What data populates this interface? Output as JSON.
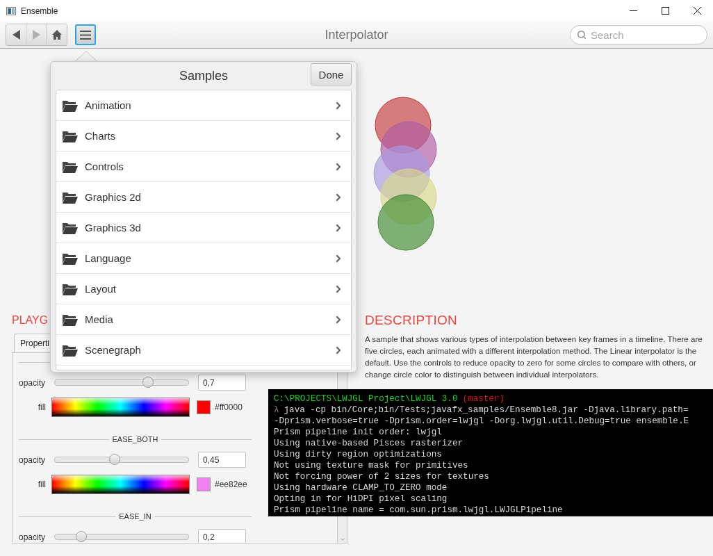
{
  "window": {
    "title": "Ensemble"
  },
  "toolbar": {
    "nav_buttons": [
      {
        "kind": "back",
        "disabled": false
      },
      {
        "kind": "forward",
        "disabled": true
      },
      {
        "kind": "home",
        "disabled": false
      }
    ],
    "menu_button": {
      "selected": true
    },
    "title": "Interpolator",
    "search": {
      "placeholder": "Search"
    }
  },
  "circles": [
    {
      "color": "#c23b3e"
    },
    {
      "color": "#b05ca8"
    },
    {
      "color": "#a99ae0"
    },
    {
      "color": "#d8d888"
    },
    {
      "color": "#3f8a30"
    }
  ],
  "playground": {
    "heading": "PLAYG",
    "tabs": [
      {
        "label": "Properti",
        "selected": true
      }
    ],
    "rows": [
      {
        "kind": "separator"
      },
      {
        "kind": "slider",
        "label": "opacity",
        "level": 0.7,
        "value": "0,7"
      },
      {
        "kind": "color",
        "label": "fill",
        "color": "#ff0000",
        "value": "#ff0000"
      },
      {
        "kind": "separator",
        "title": "EASE_BOTH"
      },
      {
        "kind": "slider",
        "label": "opacity",
        "level": 0.45,
        "value": "0,45"
      },
      {
        "kind": "color",
        "label": "fill",
        "color": "#ee82ee",
        "value": "#ee82ee"
      },
      {
        "kind": "separator",
        "title": "EASE_IN"
      },
      {
        "kind": "slider",
        "label": "opacity",
        "level": 0.2,
        "value": "0,2"
      }
    ]
  },
  "description": {
    "heading": "DESCRIPTION",
    "text": "A sample that shows various types of interpolation between key frames in a timeline. There are five circles, each animated with a different interpolation method. The Linear interpolator is the default. Use the controls to reduce opacity to zero for some circles to compare with others, or change circle color to distinguish between individual interpolators."
  },
  "terminal": {
    "lines": [
      {
        "kind": "prompt",
        "path": "C:\\PROJECTS\\LWJGL Project\\LWJGL 3.0",
        "branch": "(master)"
      },
      {
        "kind": "command",
        "symbol": "λ",
        "text": "java -cp bin/Core;bin/Tests;javafx_samples/Ensemble8.jar -Djava.library.path="
      },
      {
        "kind": "output",
        "text": "-Dprism.verbose=true -Dprism.order=lwjgl -Dorg.lwjgl.util.Debug=true ensemble.E"
      },
      {
        "kind": "output",
        "text": "Prism pipeline init order: lwjgl"
      },
      {
        "kind": "output",
        "text": "Using native-based Pisces rasterizer"
      },
      {
        "kind": "output",
        "text": "Using dirty region optimizations"
      },
      {
        "kind": "output",
        "text": "Not using texture mask for primitives"
      },
      {
        "kind": "output",
        "text": "Not forcing power of 2 sizes for textures"
      },
      {
        "kind": "output",
        "text": "Using hardware CLAMP_TO_ZERO mode"
      },
      {
        "kind": "output",
        "text": "Opting in for HiDPI pixel scaling"
      },
      {
        "kind": "output",
        "text": "Prism pipeline name = com.sun.prism.lwjgl.LWJGLPipeline"
      }
    ]
  },
  "popup": {
    "title": "Samples",
    "done": "Done",
    "items": [
      {
        "label": "Animation"
      },
      {
        "label": "Charts"
      },
      {
        "label": "Controls"
      },
      {
        "label": "Graphics 2d"
      },
      {
        "label": "Graphics 3d"
      },
      {
        "label": "Language"
      },
      {
        "label": "Layout"
      },
      {
        "label": "Media"
      },
      {
        "label": "Scenegraph"
      }
    ]
  }
}
